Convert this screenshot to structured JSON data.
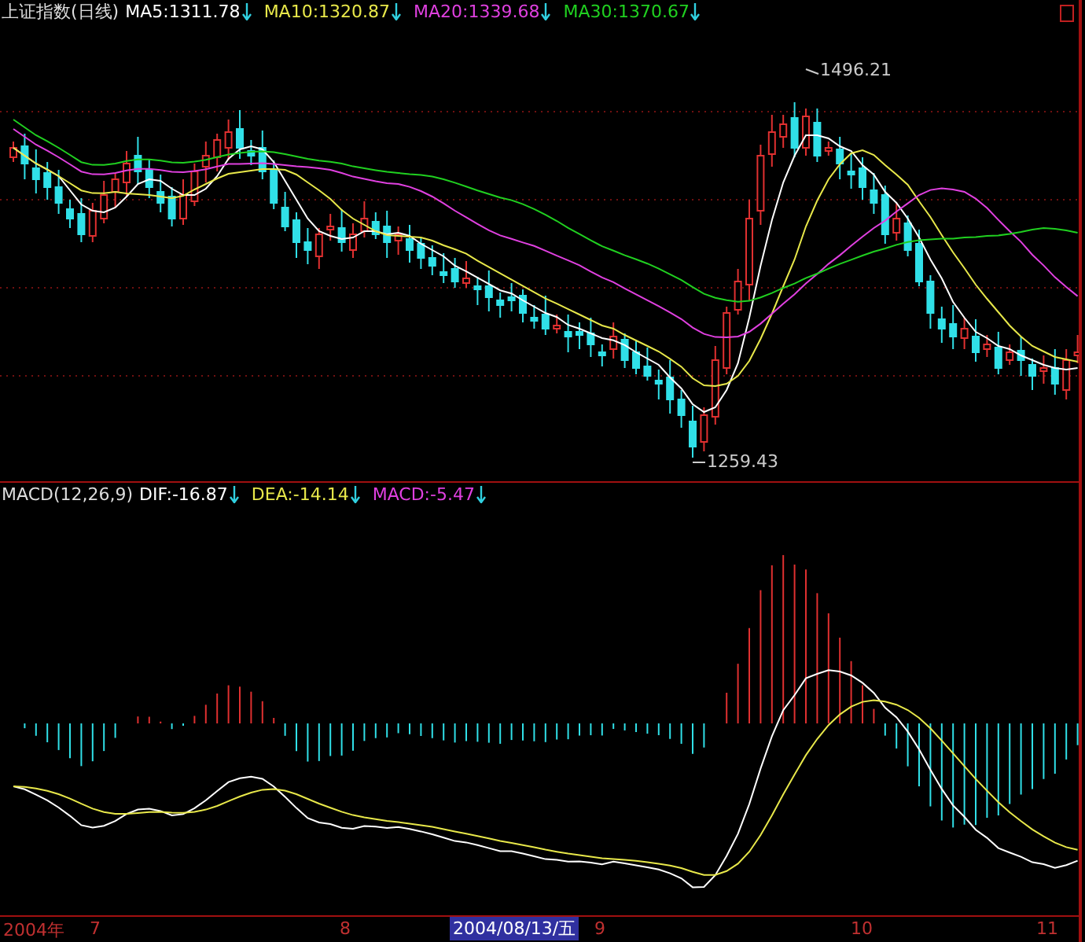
{
  "price_panel": {
    "title": "上证指数(日线)",
    "indicators": [
      {
        "label": "MA5:1311.78",
        "color": "#ffffff"
      },
      {
        "label": "MA10:1320.87",
        "color": "#e8e84a"
      },
      {
        "label": "MA20:1339.68",
        "color": "#e040e0"
      },
      {
        "label": "MA30:1370.67",
        "color": "#20d020"
      }
    ],
    "high_label": "1496.21",
    "low_label": "1259.43"
  },
  "macd_panel": {
    "title": "MACD(12,26,9)",
    "indicators": [
      {
        "label": "DIF:-16.87",
        "color": "#ffffff"
      },
      {
        "label": "DEA:-14.14",
        "color": "#e8e84a"
      },
      {
        "label": "MACD:-5.47",
        "color": "#e040e0"
      }
    ]
  },
  "time_axis": {
    "labels": [
      "2004年",
      "7",
      "8",
      "9",
      "10",
      "11"
    ],
    "cursor_date": "2004/08/13/五"
  }
}
